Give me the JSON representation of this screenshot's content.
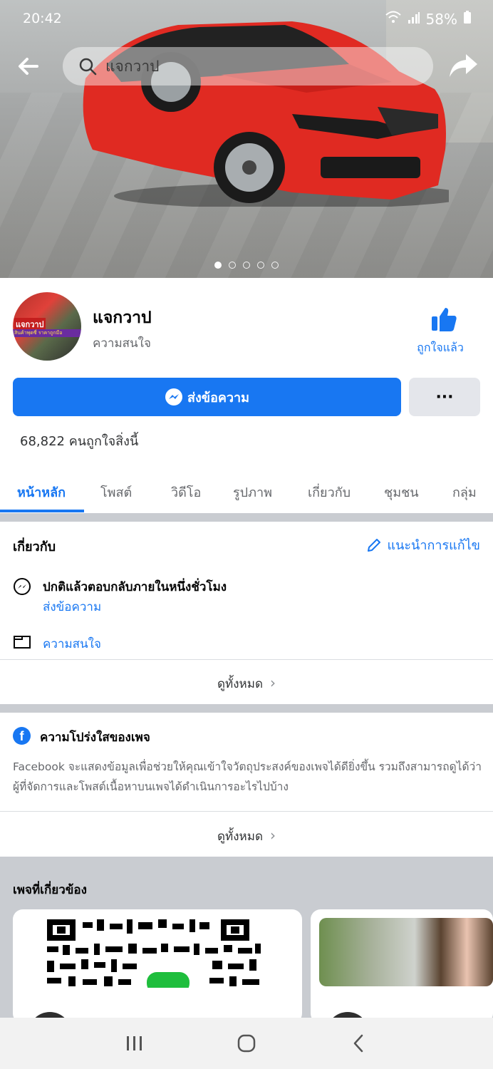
{
  "status_bar": {
    "time": "20:42",
    "battery": "58%"
  },
  "search": {
    "query": "แจกวาป"
  },
  "cover": {
    "slide_count": 5,
    "active_slide": 1
  },
  "profile": {
    "name": "แจกวาป",
    "category": "ความสนใจ",
    "avatar_text_1": "แจกวาป",
    "avatar_text_2": "สินค้าพุดซี่ ราคาถูกมือ",
    "liked_label": "ถูกใจแล้ว",
    "message_button": "ส่งข้อความ",
    "more_button": "···",
    "likes_count": "68,822 คนถูกใจสิ่งนี้"
  },
  "tabs": [
    {
      "label": "หน้าหลัก",
      "active": true
    },
    {
      "label": "โพสต์"
    },
    {
      "label": "วิดีโอ"
    },
    {
      "label": "รูปภาพ"
    },
    {
      "label": "เกี่ยวกับ"
    },
    {
      "label": "ชุมชน"
    },
    {
      "label": "กลุ่ม"
    }
  ],
  "about": {
    "title": "เกี่ยวกับ",
    "suggest_edit": "แนะนำการแก้ไข",
    "response_time": "ปกติแล้วตอบกลับภายในหนึ่งชั่วโมง",
    "send_message": "ส่งข้อความ",
    "category": "ความสนใจ",
    "see_all": "ดูทั้งหมด"
  },
  "transparency": {
    "title": "ความโปร่งใสของเพจ",
    "body": "Facebook จะแสดงข้อมูลเพื่อช่วยให้คุณเข้าใจวัตถุประสงค์ของเพจได้ดียิ่งขึ้น รวมถึงสามารถดูได้ว่าผู้ที่จัดการและโพสต์เนื้อหาบนเพจได้ดำเนินการอะไรไปบ้าง",
    "see_all": "ดูทั้งหมด"
  },
  "related": {
    "title": "เพจที่เกี่ยวข้อง"
  },
  "colors": {
    "accent": "#1877f2",
    "car": "#e02a22",
    "separator": "#c9ccd1"
  }
}
